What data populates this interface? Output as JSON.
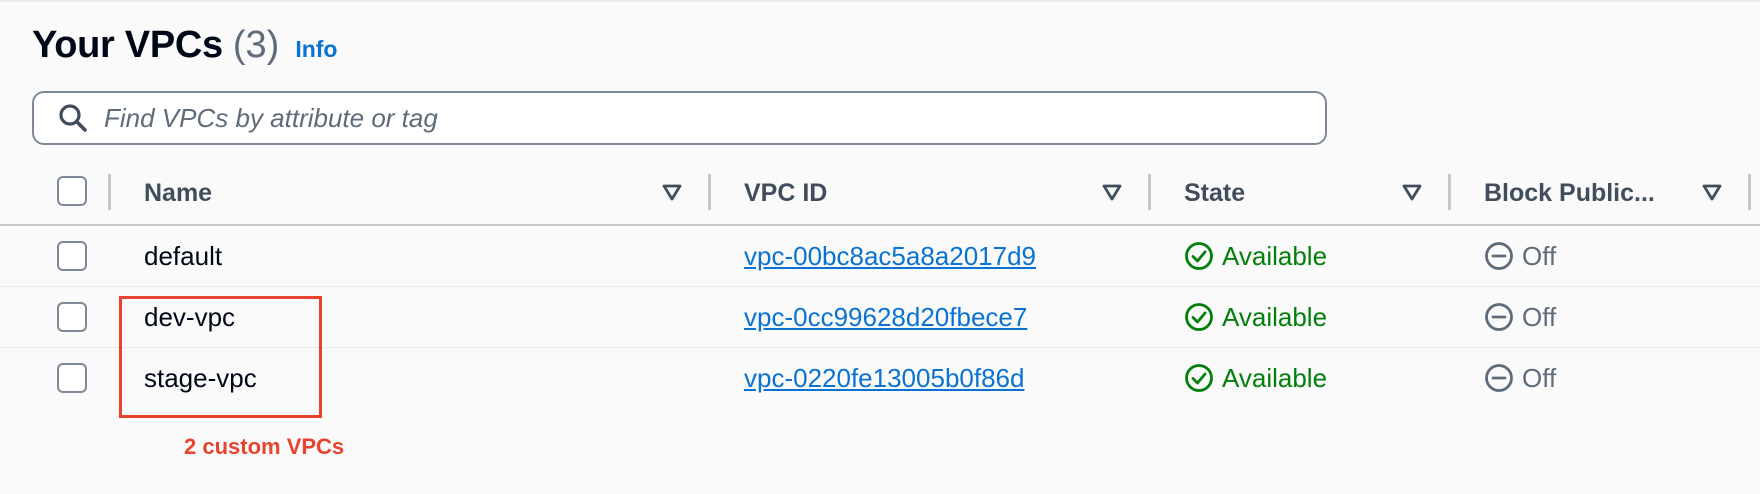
{
  "header": {
    "title": "Your VPCs",
    "count": "(3)",
    "info_link": "Info"
  },
  "search": {
    "placeholder": "Find VPCs by attribute or tag",
    "value": ""
  },
  "table": {
    "columns": [
      "Name",
      "VPC ID",
      "State",
      "Block Public..."
    ],
    "rows": [
      {
        "name": "default",
        "vpc_id": "vpc-00bc8ac5a8a2017d9",
        "state": "Available",
        "block_public": "Off"
      },
      {
        "name": "dev-vpc",
        "vpc_id": "vpc-0cc99628d20fbece7",
        "state": "Available",
        "block_public": "Off"
      },
      {
        "name": "stage-vpc",
        "vpc_id": "vpc-0220fe13005b0f86d",
        "state": "Available",
        "block_public": "Off"
      }
    ]
  },
  "annotation": {
    "label": "2 custom VPCs",
    "color": "#e8432e"
  },
  "colors": {
    "link": "#0972d3",
    "available": "#037f0c",
    "muted": "#5f6b7a",
    "heading": "#414d5c"
  },
  "icons": {
    "search": "search-icon",
    "sort": "sort-caret-down-icon",
    "available": "check-circle-icon",
    "off": "minus-circle-icon"
  }
}
